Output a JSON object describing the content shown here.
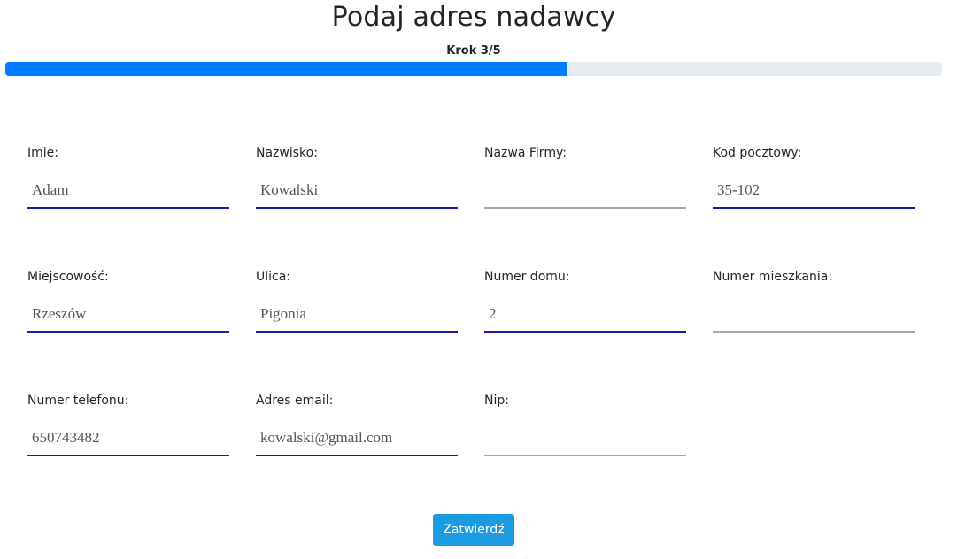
{
  "header": {
    "title": "Podaj adres nadawcy",
    "step": "Krok 3/5",
    "progress_percent": 60
  },
  "form": {
    "fields": {
      "imie": {
        "label": "Imie:",
        "value": "Adam"
      },
      "nazwisko": {
        "label": "Nazwisko:",
        "value": "Kowalski"
      },
      "nazwa_firmy": {
        "label": "Nazwa Firmy:",
        "value": ""
      },
      "kod_pocztowy": {
        "label": "Kod pocztowy:",
        "value": "35-102"
      },
      "miejscowosc": {
        "label": "Miejscowość:",
        "value": "Rzeszów"
      },
      "ulica": {
        "label": "Ulica:",
        "value": "Pigonia"
      },
      "numer_domu": {
        "label": "Numer domu:",
        "value": "2"
      },
      "numer_mieszkania": {
        "label": "Numer mieszkania:",
        "value": ""
      },
      "numer_telefonu": {
        "label": "Numer telefonu:",
        "value": "650743482"
      },
      "adres_email": {
        "label": "Adres email:",
        "value": "kowalski@gmail.com"
      },
      "nip": {
        "label": "Nip:",
        "value": ""
      }
    },
    "submit_label": "Zatwierdź"
  },
  "colors": {
    "progress_fill": "#007bff",
    "progress_track": "#e9ecef",
    "filled_underline": "#1a1aa8",
    "empty_underline": "#a9a9a9",
    "submit_button": "#1b9ce2"
  }
}
